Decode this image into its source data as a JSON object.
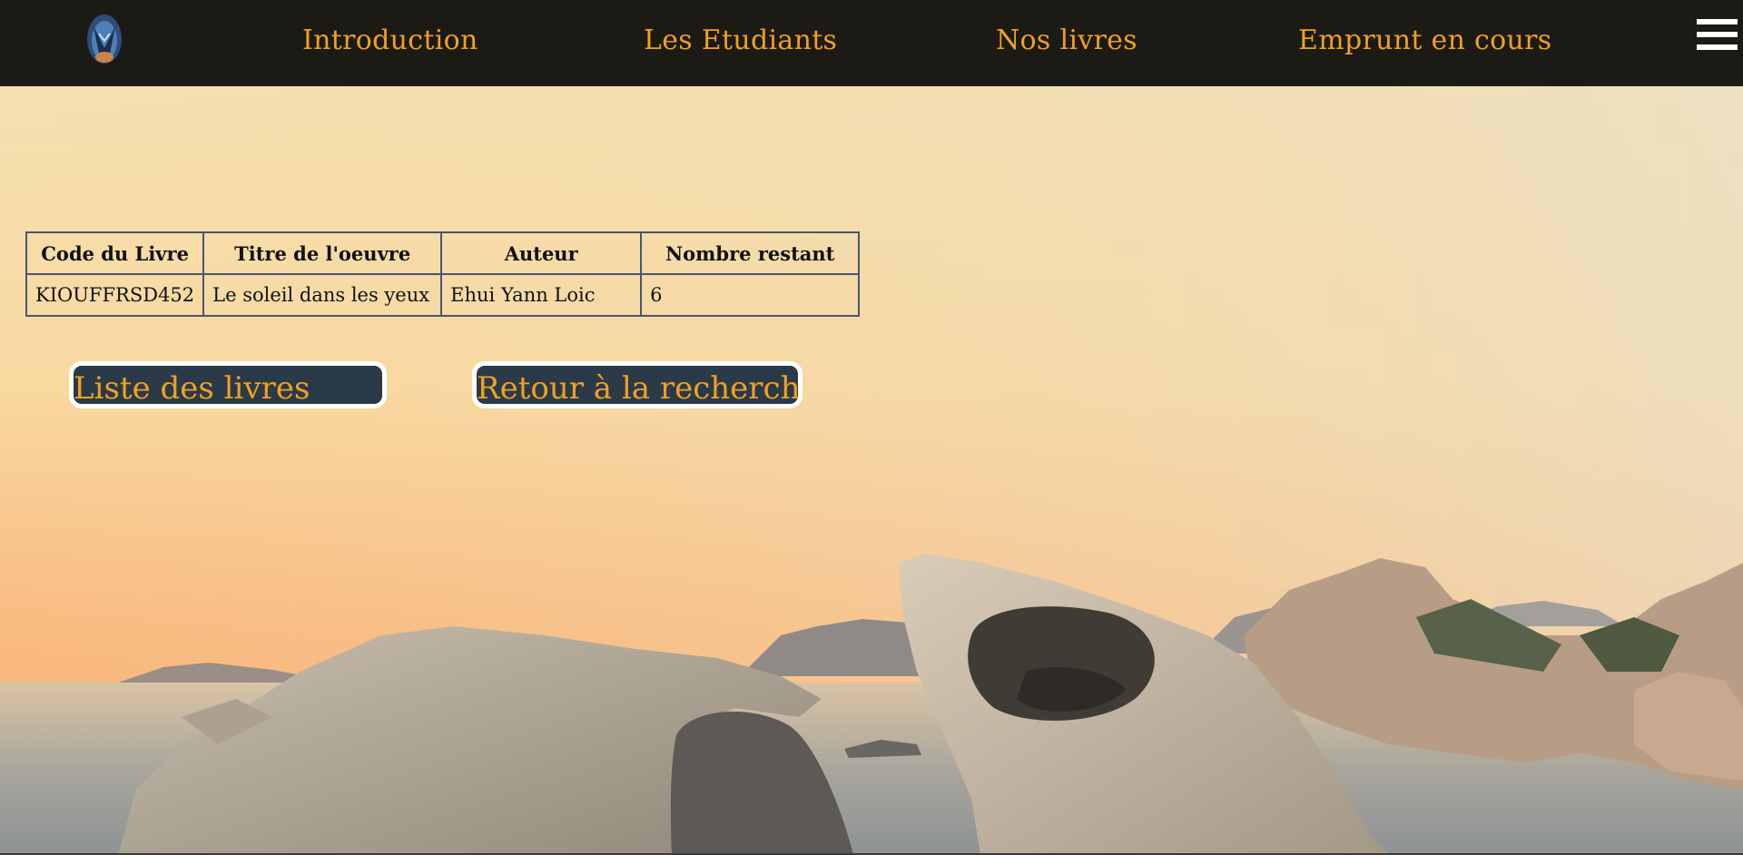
{
  "nav": {
    "logo_icon": "bird-logo-icon",
    "links": [
      {
        "label": "Introduction"
      },
      {
        "label": "Les Etudiants"
      },
      {
        "label": "Nos livres"
      },
      {
        "label": "Emprunt en cours"
      }
    ],
    "menu_icon": "hamburger-menu-icon"
  },
  "table": {
    "headers": [
      "Code du Livre",
      "Titre de l'oeuvre",
      "Auteur",
      "Nombre restant"
    ],
    "rows": [
      [
        "KIOUFFRSD452",
        "Le soleil dans les yeux",
        "Ehui Yann Loic",
        "6"
      ]
    ]
  },
  "buttons": {
    "list_label": "Liste des livres",
    "back_label": "Retour à la rechercher"
  },
  "colors": {
    "nav_background": "#1c1a15",
    "accent": "#f0a020",
    "button_background": "#2b3a48",
    "table_border": "#4a5670"
  }
}
